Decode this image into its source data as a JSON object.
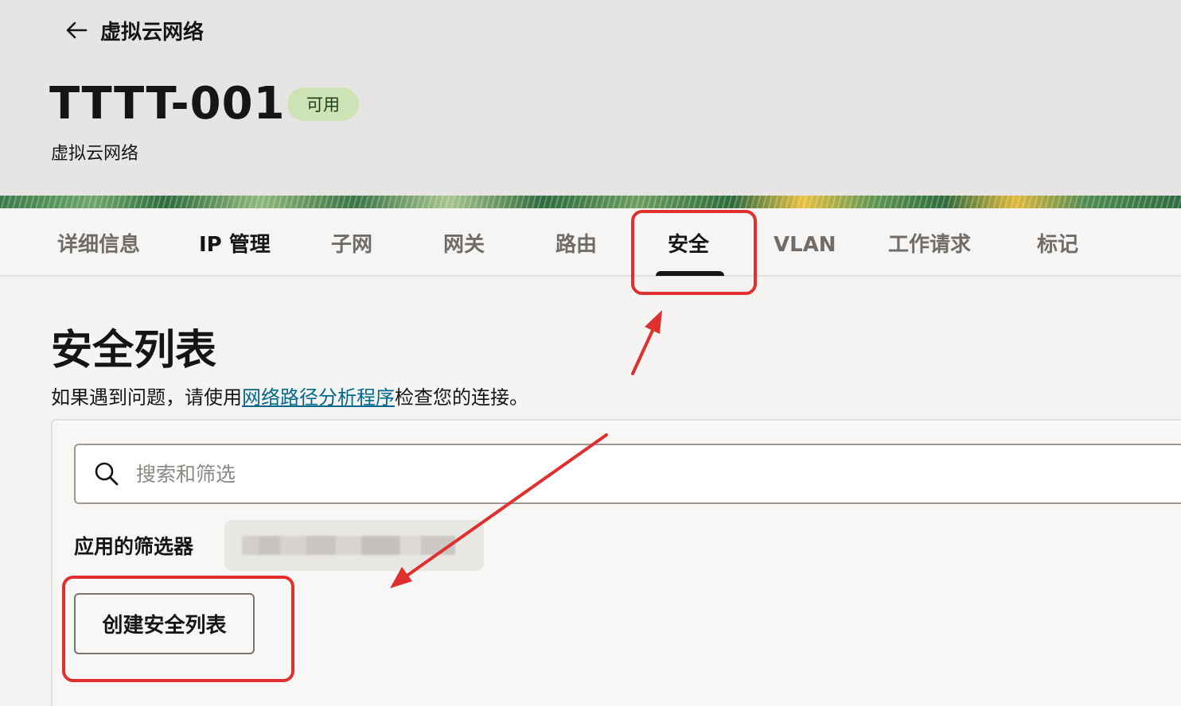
{
  "header": {
    "back_label": "虚拟云网络",
    "title": "TTTT-001",
    "status": "可用",
    "resource_type": "虚拟云网络"
  },
  "tabs": [
    {
      "label": "详细信息"
    },
    {
      "label": "IP 管理"
    },
    {
      "label": "子网"
    },
    {
      "label": "网关"
    },
    {
      "label": "路由"
    },
    {
      "label": "安全",
      "active": true
    },
    {
      "label": "VLAN"
    },
    {
      "label": "工作请求"
    },
    {
      "label": "标记"
    }
  ],
  "main": {
    "section_title": "安全列表",
    "help_prefix": "如果遇到问题，请使用",
    "help_link": "网络路径分析程序",
    "help_suffix": "检查您的连接。",
    "search_placeholder": "搜索和筛选",
    "filters_label": "应用的筛选器",
    "create_button": "创建安全列表"
  },
  "colors": {
    "annotation": "#e02f2f",
    "link": "#00688c",
    "badge_bg": "#cde2b5"
  },
  "icons": {
    "back": "arrow-left-icon",
    "search": "search-icon"
  }
}
